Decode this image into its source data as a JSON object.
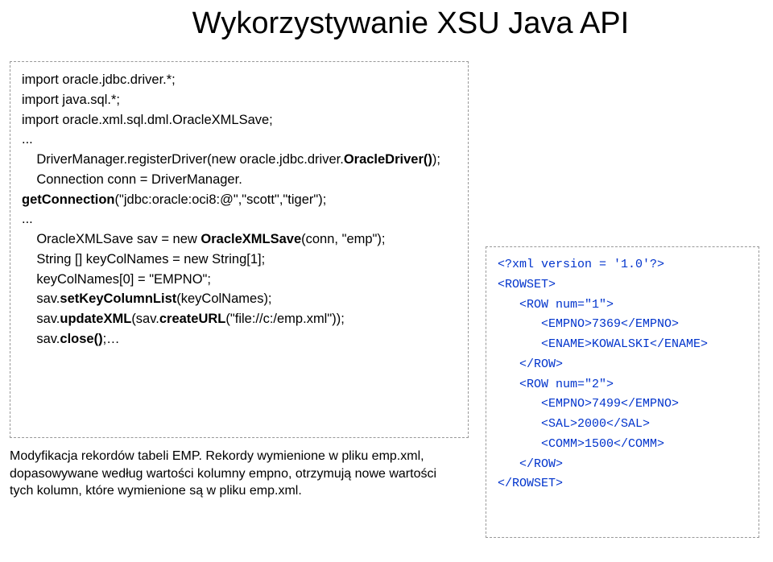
{
  "title": "Wykorzystywanie XSU Java API",
  "code": {
    "l1": "import oracle.jdbc.driver.*;",
    "l2": "import java.sql.*;",
    "l3": "import oracle.xml.sql.dml.OracleXMLSave;",
    "l4": "...",
    "l5a": "    DriverManager.registerDriver(new oracle.jdbc.driver.",
    "l5b": "OracleDriver()",
    "l5c": ");",
    "l6": "    Connection conn = DriverManager.",
    "l7a": "getConnection",
    "l7b": "(\"jdbc:oracle:oci8:@\",\"scott\",\"tiger\");",
    "l8": "...",
    "l9a": "    OracleXMLSave sav = new ",
    "l9b": "OracleXMLSave",
    "l9c": "(conn, \"emp\");",
    "l10": "    String [] keyColNames = new String[1];",
    "l11": "    keyColNames[0] = \"EMPNO\";",
    "l12a": "    sav.",
    "l12b": "setKeyColumnList",
    "l12c": "(keyColNames);",
    "l13a": "    sav.",
    "l13b": "updateXML",
    "l13c": "(sav.",
    "l13d": "createURL",
    "l13e": "(\"file://c:/emp.xml\"));",
    "l14a": "    sav.",
    "l14b": "close()",
    "l14c": ";…"
  },
  "caption": "Modyfikacja rekordów tabeli EMP. Rekordy wymienione w pliku emp.xml, dopasowywane według wartości kolumny empno, otrzymują nowe wartości tych kolumn, które wymienione są w pliku emp.xml.",
  "xml": {
    "l1": "<?xml version = '1.0'?>",
    "l2": "<ROWSET>",
    "l3": "   <ROW num=\"1\">",
    "l4": "      <EMPNO>7369</EMPNO>",
    "l5": "      <ENAME>KOWALSKI</ENAME>",
    "l6": "   </ROW>",
    "l7": "   <ROW num=\"2\">",
    "l8": "      <EMPNO>7499</EMPNO>",
    "l9": "      <SAL>2000</SAL>",
    "l10": "      <COMM>1500</COMM>",
    "l11": "   </ROW>",
    "l12": "</ROWSET>"
  }
}
